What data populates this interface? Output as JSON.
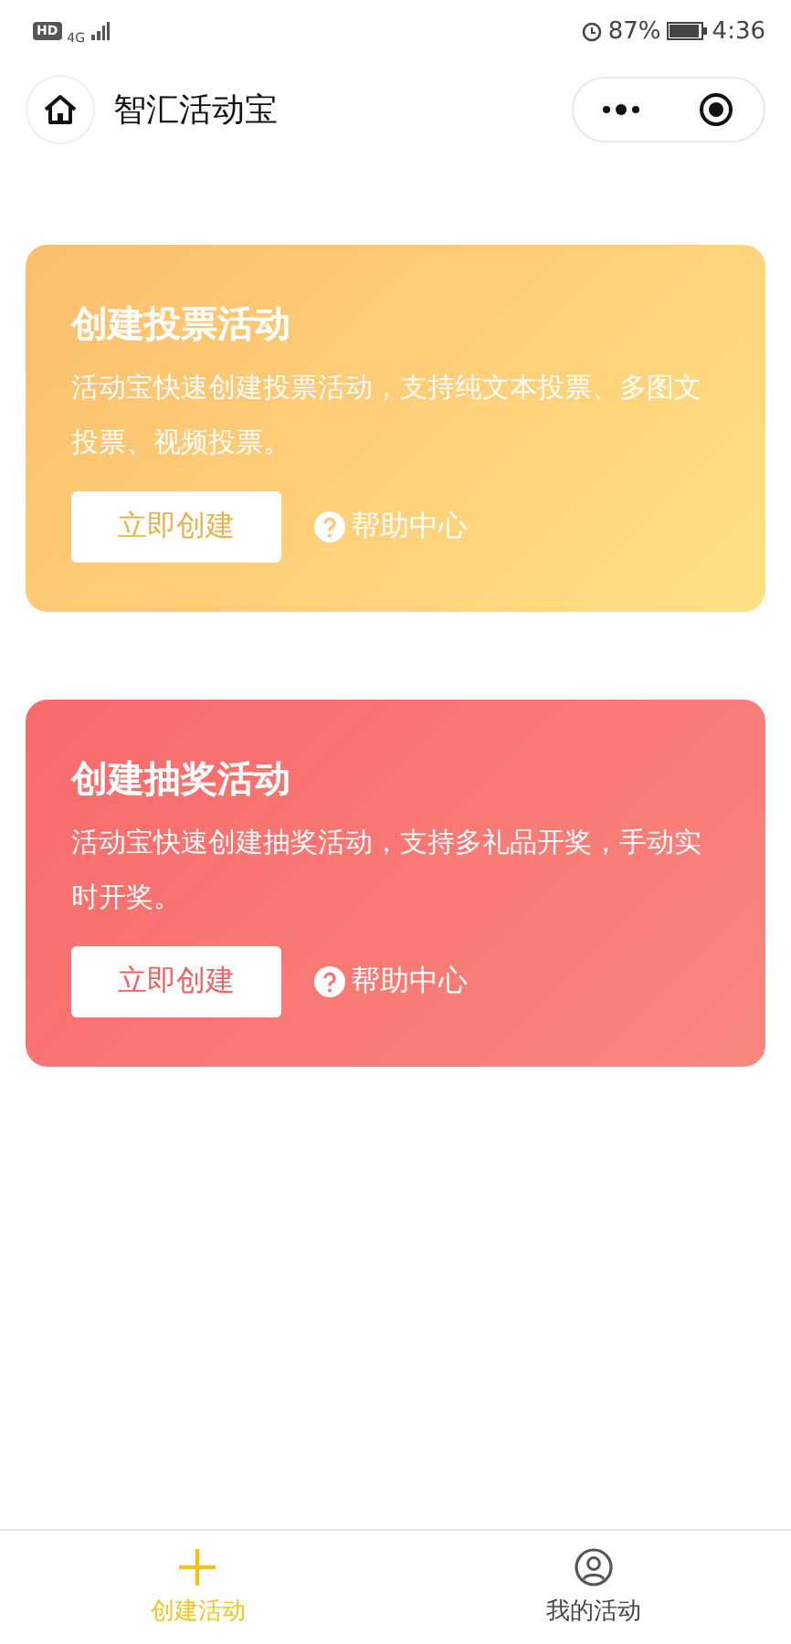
{
  "status_bar": {
    "hd": "HD",
    "network": "4G",
    "battery": "87%",
    "time": "4:36"
  },
  "header": {
    "title": "智汇活动宝"
  },
  "cards": [
    {
      "kind": "vote",
      "title": "创建投票活动",
      "description": "活动宝快速创建投票活动，支持纯文本投票、多图文投票、视频投票。",
      "button": "立即创建",
      "help": "帮助中心"
    },
    {
      "kind": "lottery",
      "title": "创建抽奖活动",
      "description": "活动宝快速创建抽奖活动，支持多礼品开奖，手动实时开奖。",
      "button": "立即创建",
      "help": "帮助中心"
    }
  ],
  "tab_bar": [
    {
      "kind": "create",
      "label": "创建活动",
      "selected": true
    },
    {
      "kind": "mine",
      "label": "我的活动",
      "selected": false
    }
  ]
}
